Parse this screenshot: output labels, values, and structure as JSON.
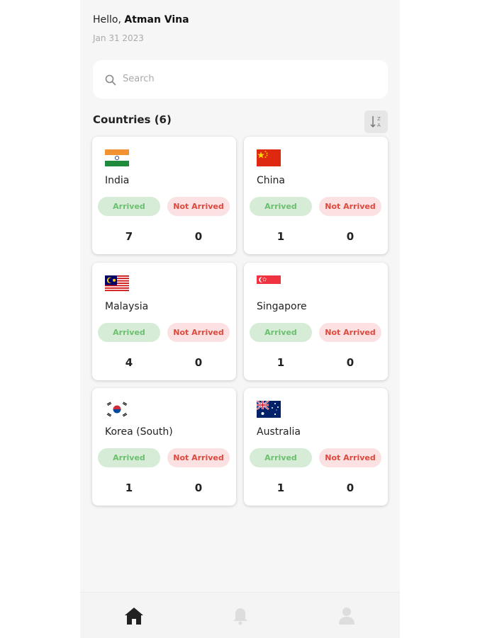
{
  "header": {
    "greeting": "Hello,",
    "user_name": "Atman Vina",
    "date": "Jan 31 2023"
  },
  "search": {
    "placeholder": "Search",
    "icon": "search-icon"
  },
  "section": {
    "title": "Countries (6)",
    "sort_icon": "sort-icon"
  },
  "countries": [
    {
      "name": "India",
      "flag": "flag-india",
      "arrived_label": "Arrived",
      "not_arrived_label": "Not Arrived",
      "arrived": "7",
      "not_arrived": "0"
    },
    {
      "name": "China",
      "flag": "flag-china",
      "arrived_label": "Arrived",
      "not_arrived_label": "Not Arrived",
      "arrived": "1",
      "not_arrived": "0"
    },
    {
      "name": "Malaysia",
      "flag": "flag-malaysia",
      "arrived_label": "Arrived",
      "not_arrived_label": "Not Arrived",
      "arrived": "4",
      "not_arrived": "0"
    },
    {
      "name": "Singapore",
      "flag": "flag-singapore",
      "arrived_label": "Arrived",
      "not_arrived_label": "Not Arrived",
      "arrived": "1",
      "not_arrived": "0"
    },
    {
      "name": "Korea (South)",
      "flag": "flag-korea",
      "arrived_label": "Arrived",
      "not_arrived_label": "Not Arrived",
      "arrived": "1",
      "not_arrived": "0"
    },
    {
      "name": "Australia",
      "flag": "flag-australia",
      "arrived_label": "Arrived",
      "not_arrived_label": "Not Arrived",
      "arrived": "1",
      "not_arrived": "0"
    }
  ],
  "bottom_nav": [
    {
      "icon": "home-icon",
      "active": true
    },
    {
      "icon": "bell-icon",
      "active": false
    },
    {
      "icon": "user-icon",
      "active": false
    }
  ],
  "colors": {
    "arrived_bg": "#d6ecd6",
    "arrived_text": "#6cbf70",
    "not_arrived_bg": "#fbe1e1",
    "not_arrived_text": "#e0483d",
    "nav_active": "#222222",
    "nav_inactive": "#dddddd"
  }
}
